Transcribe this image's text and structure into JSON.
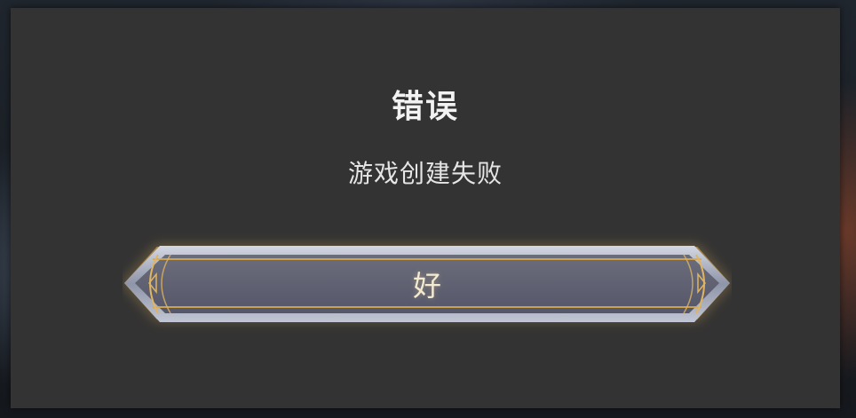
{
  "dialog": {
    "title": "错误",
    "message": "游戏创建失败",
    "ok_label": "好"
  },
  "colors": {
    "panel_bg": "#333333",
    "button_fill": "#5c5e6c",
    "button_gold_trim": "#d9a84a",
    "button_silver_frame": "#a9aebf"
  },
  "icons": {
    "button_frame": "ornate-silver-gold-frame"
  }
}
